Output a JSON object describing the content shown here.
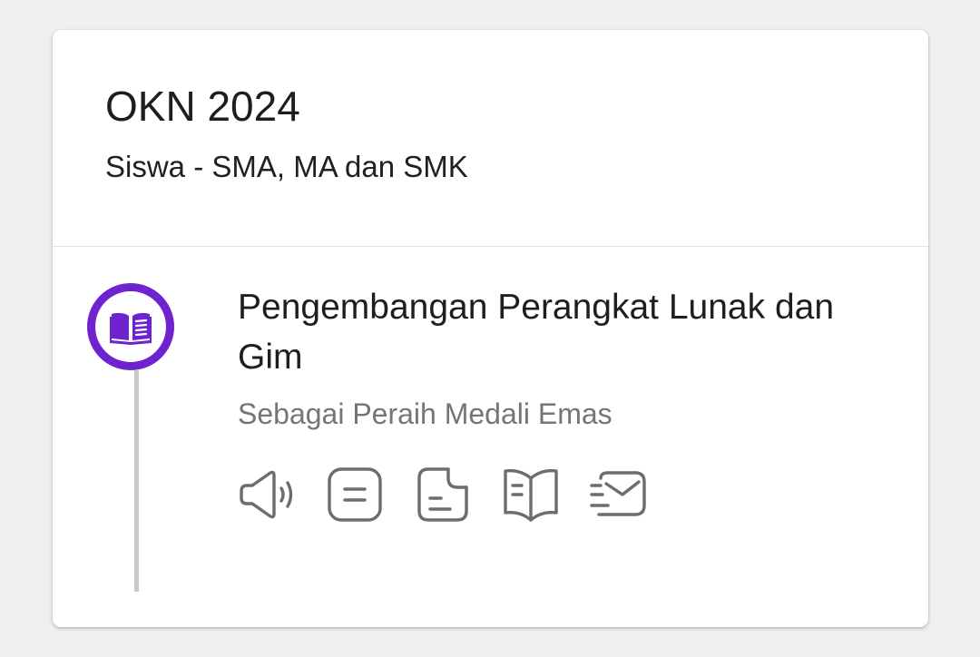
{
  "card": {
    "title": "OKN 2024",
    "subtitle": "Siswa - SMA, MA dan SMK"
  },
  "entry": {
    "icon": "open-book-icon",
    "title": "Pengembangan Perangkat Lunak dan Gim",
    "description": "Sebagai Peraih Medali Emas"
  },
  "actions": [
    {
      "icon": "speaker-icon"
    },
    {
      "icon": "note-icon"
    },
    {
      "icon": "document-icon"
    },
    {
      "icon": "book-icon"
    },
    {
      "icon": "send-mail-icon"
    }
  ],
  "colors": {
    "accent": "#6e23cf",
    "timeline": "#c9c9c9",
    "icon": "#6d6d6d",
    "description": "#757575"
  }
}
